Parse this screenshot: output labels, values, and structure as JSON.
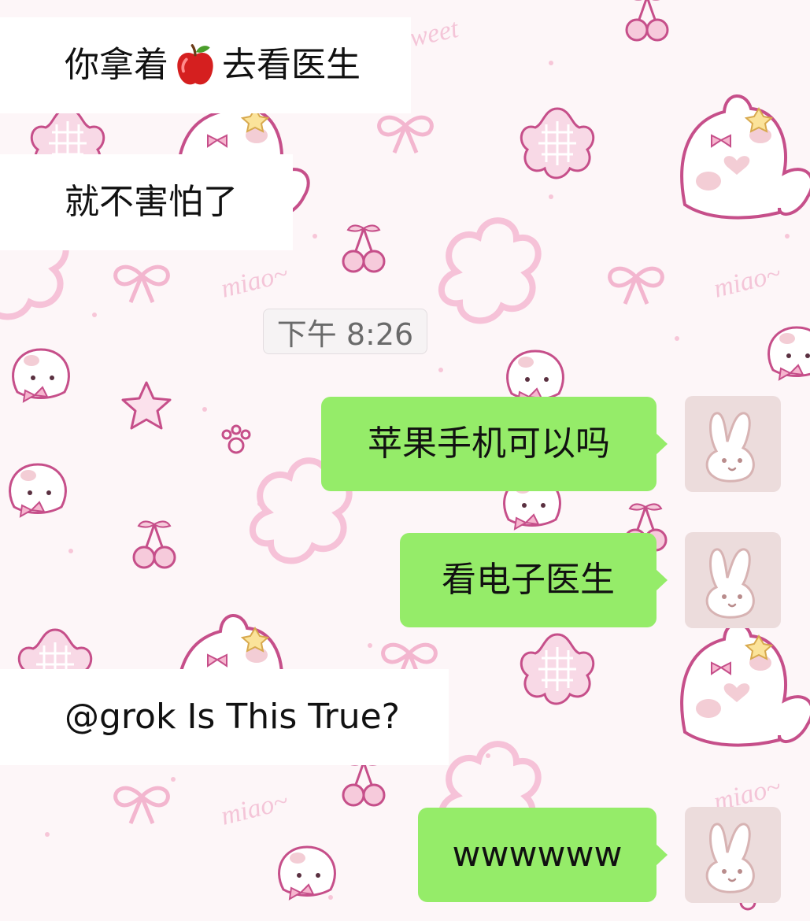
{
  "messages": [
    {
      "side": "incoming",
      "text_before": "你拿着",
      "emoji": "apple-emoji",
      "text_after": "去看医生"
    },
    {
      "side": "incoming",
      "text": "就不害怕了"
    },
    {
      "side": "outgoing",
      "text": "苹果手机可以吗"
    },
    {
      "side": "outgoing",
      "text": "看电子医生"
    },
    {
      "side": "incoming",
      "text": "@grok Is This True?"
    },
    {
      "side": "outgoing",
      "text": "wwwwww"
    }
  ],
  "timestamp": "下午 8:26",
  "wallpaper": {
    "watermark_texts": [
      "sweet",
      "miao~",
      "miao~",
      "miao~",
      "miao~"
    ]
  },
  "avatar": {
    "icon": "bunny-avatar-icon"
  },
  "colors": {
    "outgoing_bubble": "#95ec69",
    "incoming_bubble": "#ffffff",
    "wallpaper": "#fdf6f8",
    "avatar_bg": "#ecdcdc",
    "doodle_pink": "#f3b6cf",
    "doodle_magenta": "#c64f8a"
  }
}
